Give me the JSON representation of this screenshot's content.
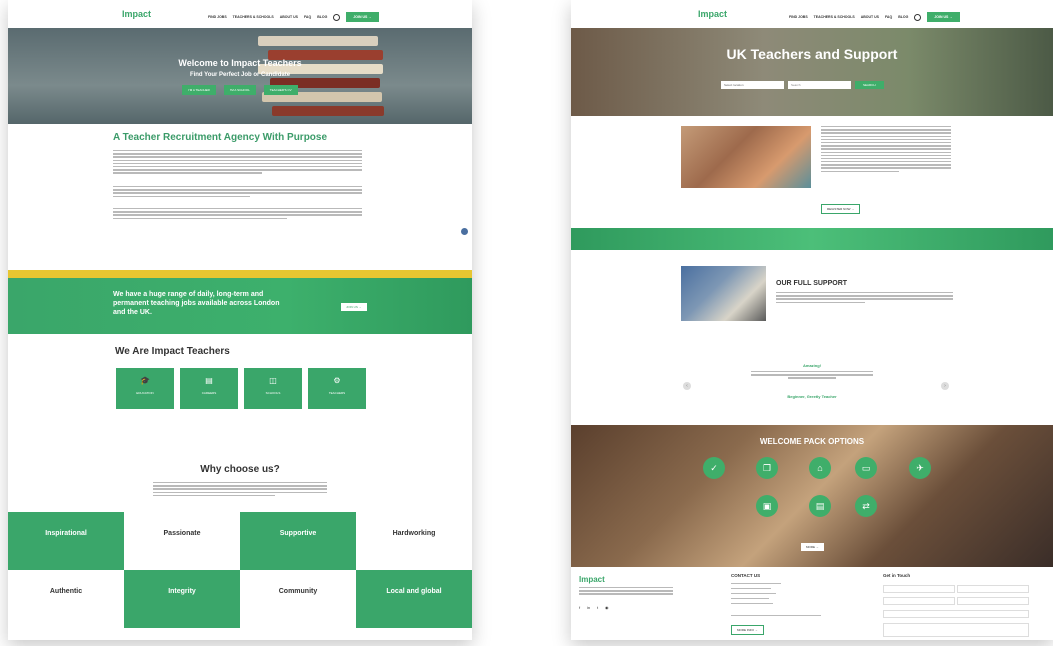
{
  "left": {
    "nav": {
      "logo": "Impact",
      "links": [
        "FIND JOBS",
        "TEACHERS & SCHOOLS",
        "ABOUT US",
        "FAQ",
        "BLOG"
      ],
      "cta": "JOIN US →"
    },
    "hero": {
      "title": "Welcome to Impact Teachers",
      "subtitle": "Find Your Perfect Job or Candidate",
      "buttons": [
        "I'M A TEACHER",
        "I'M A SCHOOL",
        "TEACHER'S CV"
      ]
    },
    "agency_title": "A Teacher Recruitment Agency With Purpose",
    "banner": {
      "text": "We have a huge range of daily, long-term and permanent teaching jobs available across London and the UK.",
      "btn": "JOIN US →"
    },
    "we_are": {
      "title": "We Are Impact Teachers",
      "tiles": [
        {
          "icon": "🎓",
          "label": "EDUCATION"
        },
        {
          "icon": "▤",
          "label": "CAREERS"
        },
        {
          "icon": "◫",
          "label": "SCHOOLS"
        },
        {
          "icon": "⚙",
          "label": "TEACHERS"
        }
      ]
    },
    "why": {
      "title": "Why choose us?",
      "cells": [
        {
          "title": "Inspirational",
          "style": "g"
        },
        {
          "title": "Passionate",
          "style": "w"
        },
        {
          "title": "Supportive",
          "style": "g"
        },
        {
          "title": "Hardworking",
          "style": "w"
        },
        {
          "title": "Authentic",
          "style": "w"
        },
        {
          "title": "Integrity",
          "style": "g"
        },
        {
          "title": "Community",
          "style": "w"
        },
        {
          "title": "Local and global",
          "style": "g"
        }
      ]
    }
  },
  "right": {
    "nav": {
      "logo": "Impact",
      "links": [
        "FIND JOBS",
        "TEACHERS & SCHOOLS",
        "ABOUT US",
        "FAQ",
        "BLOG"
      ],
      "cta": "JOIN US →"
    },
    "hero": {
      "title": "UK Teachers and Support",
      "select": "Select location",
      "search_placeholder": "Search",
      "search_btn": "SEARCH"
    },
    "intro_btn": "REGISTER NOW →",
    "support_title": "OUR FULL SUPPORT",
    "quote_title": "Amazing!",
    "quote_author": "Beginner, Greetly Teacher",
    "welcome": {
      "title": "WELCOME PACK OPTIONS",
      "btn": "MORE →"
    },
    "footer": {
      "logo": "Impact",
      "contact": "CONTACT US",
      "get_in_touch": "Get in Touch",
      "more_btn": "MORE INFO →"
    }
  }
}
